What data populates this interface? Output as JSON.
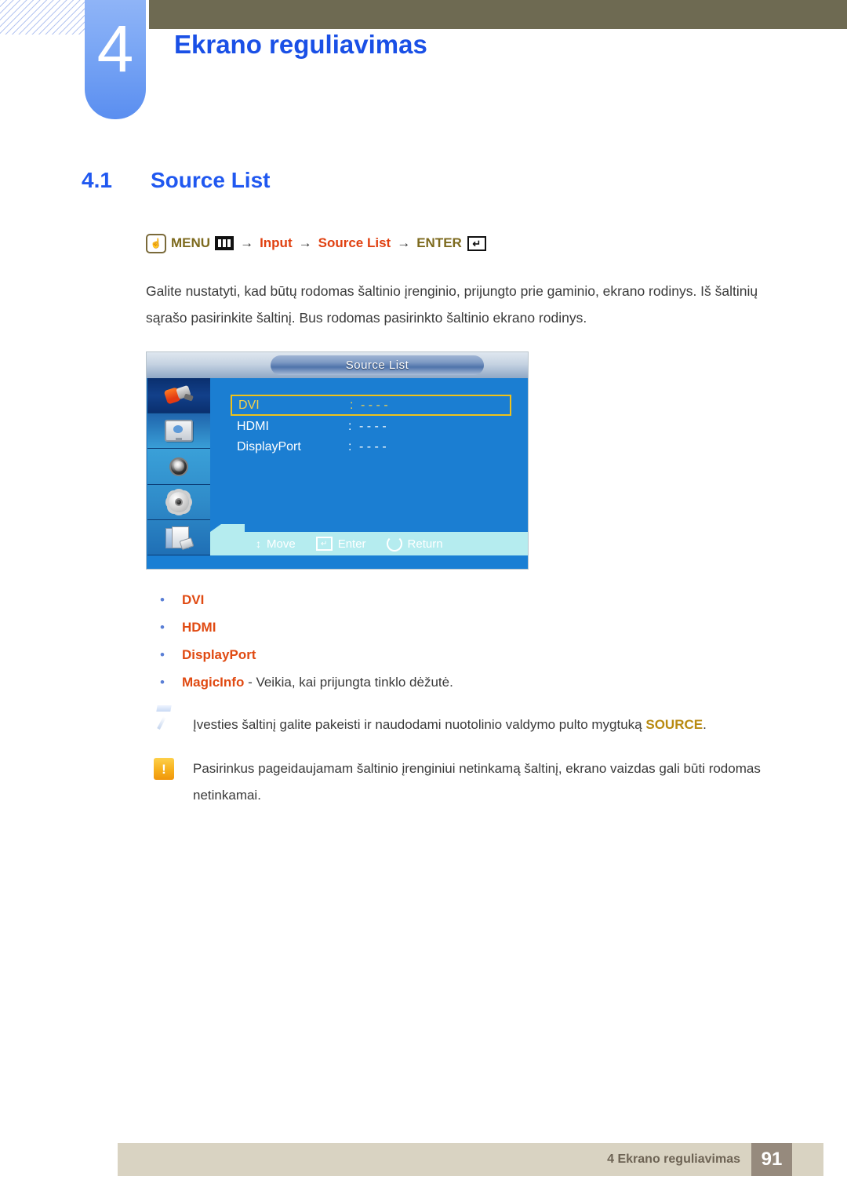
{
  "header": {
    "chapter_number": "4",
    "chapter_title": "Ekrano reguliavimas"
  },
  "section": {
    "number": "4.1",
    "title": "Source List"
  },
  "menu_path": {
    "press_icon": "hand-press-icon",
    "menu_label": "MENU",
    "bars_icon": "menu-bars-icon",
    "arrow1": "→",
    "input_label": "Input",
    "arrow2": "→",
    "source_list_label": "Source List",
    "arrow3": "→",
    "enter_label": "ENTER",
    "enter_icon": "enter-key-icon"
  },
  "body_paragraph": "Galite nustatyti, kad būtų rodomas šaltinio įrenginio, prijungto prie gaminio, ekrano rodinys. Iš šaltinių sąrašo pasirinkite šaltinį. Bus rodomas pasirinkto šaltinio ekrano rodinys.",
  "osd": {
    "title": "Source List",
    "sidebar_icons": [
      "input-cable-icon",
      "picture-screen-icon",
      "sound-speaker-icon",
      "setup-gear-icon",
      "multi-control-icon"
    ],
    "rows": [
      {
        "label": "DVI",
        "separator": ":",
        "value": "- - - -",
        "selected": true
      },
      {
        "label": "HDMI",
        "separator": ":",
        "value": "- - - -",
        "selected": false
      },
      {
        "label": "DisplayPort",
        "separator": ":",
        "value": "- - - -",
        "selected": false
      }
    ],
    "hints": [
      {
        "icon": "move-updown-icon",
        "label": "Move",
        "glyph": "↕"
      },
      {
        "icon": "enter-key-icon",
        "label": "Enter",
        "glyph": "↵"
      },
      {
        "icon": "return-arrow-icon",
        "label": "Return",
        "glyph": ""
      }
    ]
  },
  "bullets": [
    {
      "bullet": "•",
      "term": "DVI",
      "rest": ""
    },
    {
      "bullet": "•",
      "term": "HDMI",
      "rest": ""
    },
    {
      "bullet": "•",
      "term": "DisplayPort",
      "rest": ""
    },
    {
      "bullet": "•",
      "term": "MagicInfo",
      "rest": " - Veikia, kai prijungta tinklo dėžutė."
    }
  ],
  "notes": [
    {
      "icon": "note-pencil-icon",
      "text_before": "Įvesties šaltinį galite pakeisti ir naudodami nuotolinio valdymo pulto mygtuką ",
      "emphasis": "SOURCE",
      "text_after": "."
    },
    {
      "icon": "warning-exclamation-icon",
      "text_before": "Pasirinkus pageidaujamam šaltinio įrenginiui netinkamą šaltinį, ekrano vaizdas gali būti rodomas netinkamai.",
      "emphasis": "",
      "text_after": ""
    }
  ],
  "footer": {
    "label": "4 Ekrano reguliavimas",
    "page": "91"
  },
  "colors": {
    "heading_blue": "#2058f0",
    "accent_red": "#e04a12",
    "olive": "#7d6a1e",
    "osd_blue": "#1b7ed2",
    "osd_highlight": "#f0c219",
    "footer_beige": "#d9d3c2",
    "footer_page_box": "#968a7d",
    "header_olive_bar": "#6e6a52"
  }
}
